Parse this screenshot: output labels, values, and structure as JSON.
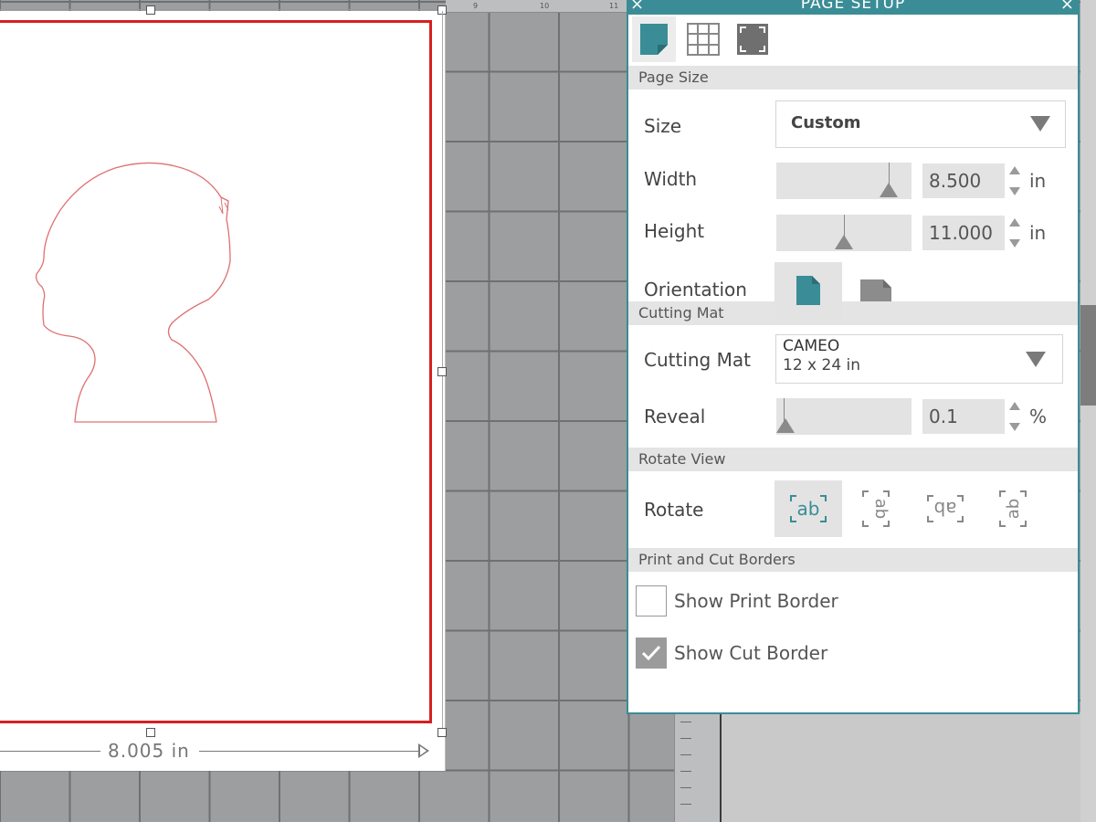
{
  "panel": {
    "title": "PAGE SETUP",
    "close_glyph": "×",
    "tabs": [
      {
        "icon": "page-icon",
        "active": true
      },
      {
        "icon": "grid-icon",
        "active": false
      },
      {
        "icon": "registration-marks-icon",
        "active": false
      }
    ]
  },
  "page_size": {
    "section_title": "Page Size",
    "size_label": "Size",
    "size_value": "Custom",
    "width_label": "Width",
    "width_value": "8.500",
    "width_unit": "in",
    "height_label": "Height",
    "height_value": "11.000",
    "height_unit": "in",
    "orientation_label": "Orientation",
    "orientation_options": [
      "portrait",
      "landscape"
    ],
    "orientation_selected": "portrait"
  },
  "cutting_mat": {
    "section_title": "Cutting Mat",
    "mat_label": "Cutting Mat",
    "mat_name": "CAMEO",
    "mat_size": "12 x 24 in",
    "reveal_label": "Reveal",
    "reveal_value": "0.1",
    "reveal_unit": "%"
  },
  "rotate_view": {
    "section_title": "Rotate View",
    "rotate_label": "Rotate",
    "option_text": "ab",
    "selected_index": 0
  },
  "borders": {
    "section_title": "Print and Cut Borders",
    "print_border_label": "Show Print Border",
    "print_border_checked": false,
    "cut_border_label": "Show Cut Border",
    "cut_border_checked": true
  },
  "canvas": {
    "measure_label": "8.005 in",
    "ruler_numbers": [
      "9",
      "10",
      "11"
    ]
  },
  "colors": {
    "accent": "#3a8d96",
    "cut_border": "#d62020",
    "silhouette_stroke": "#e07070"
  }
}
